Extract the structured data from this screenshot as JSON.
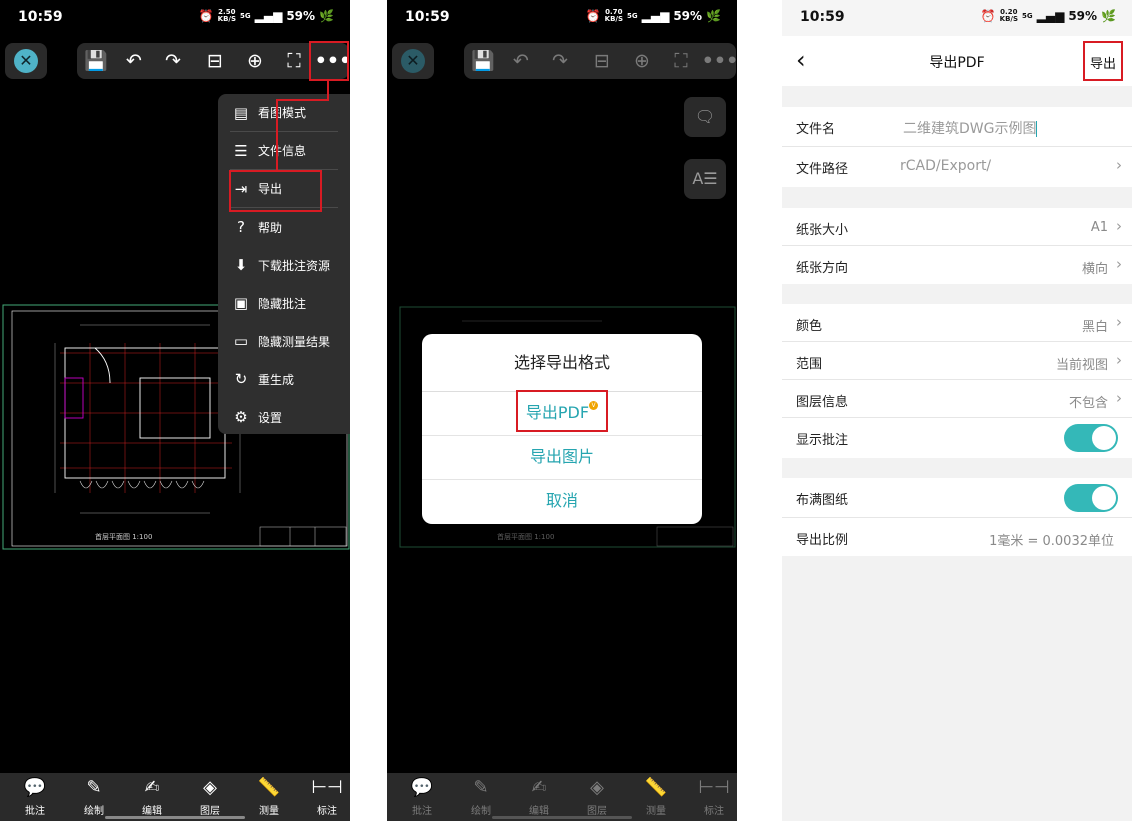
{
  "status": {
    "time": "10:59",
    "battery": "59%",
    "net_speed_1": "2.50",
    "net_speed_2": "0.70",
    "net_speed_3": "0.20",
    "speed_unit": "KB/S",
    "signal": "5G"
  },
  "screen1": {
    "menu_items": [
      {
        "label": "看图模式",
        "icon": "view-mode-icon"
      },
      {
        "label": "文件信息",
        "icon": "file-info-icon"
      },
      {
        "label": "导出",
        "icon": "export-icon"
      },
      {
        "label": "帮助",
        "icon": "help-icon"
      },
      {
        "label": "下载批注资源",
        "icon": "download-icon"
      },
      {
        "label": "隐藏批注",
        "icon": "hide-annotation-icon"
      },
      {
        "label": "隐藏测量结果",
        "icon": "hide-measure-icon"
      },
      {
        "label": "重生成",
        "icon": "regenerate-icon"
      },
      {
        "label": "设置",
        "icon": "gear-icon"
      }
    ]
  },
  "bottom_bar": [
    "批注",
    "绘制",
    "编辑",
    "图层",
    "测量",
    "标注"
  ],
  "drawing": {
    "caption": "首层平面图 1:100"
  },
  "dialog": {
    "title": "选择导出格式",
    "option_pdf": "导出PDF",
    "vip_badge": "V",
    "option_image": "导出图片",
    "cancel": "取消"
  },
  "settings": {
    "nav_title": "导出PDF",
    "nav_action": "导出",
    "filename_label": "文件名",
    "filename_value": "二维建筑DWG示例图",
    "filepath_label": "文件路径",
    "filepath_value": "rCAD/Export/",
    "paper_size_label": "纸张大小",
    "paper_size_value": "A1",
    "orientation_label": "纸张方向",
    "orientation_value": "横向",
    "color_label": "颜色",
    "color_value": "黑白",
    "range_label": "范围",
    "range_value": "当前视图",
    "layer_label": "图层信息",
    "layer_value": "不包含",
    "show_annotation_label": "显示批注",
    "show_annotation_on": true,
    "fill_paper_label": "布满图纸",
    "fill_paper_on": true,
    "scale_label": "导出比例",
    "scale_value": "1毫米 = 0.0032单位"
  },
  "colors": {
    "accent": "#26a5b0",
    "highlight": "#d81b23",
    "toggle": "#34b8b8"
  }
}
